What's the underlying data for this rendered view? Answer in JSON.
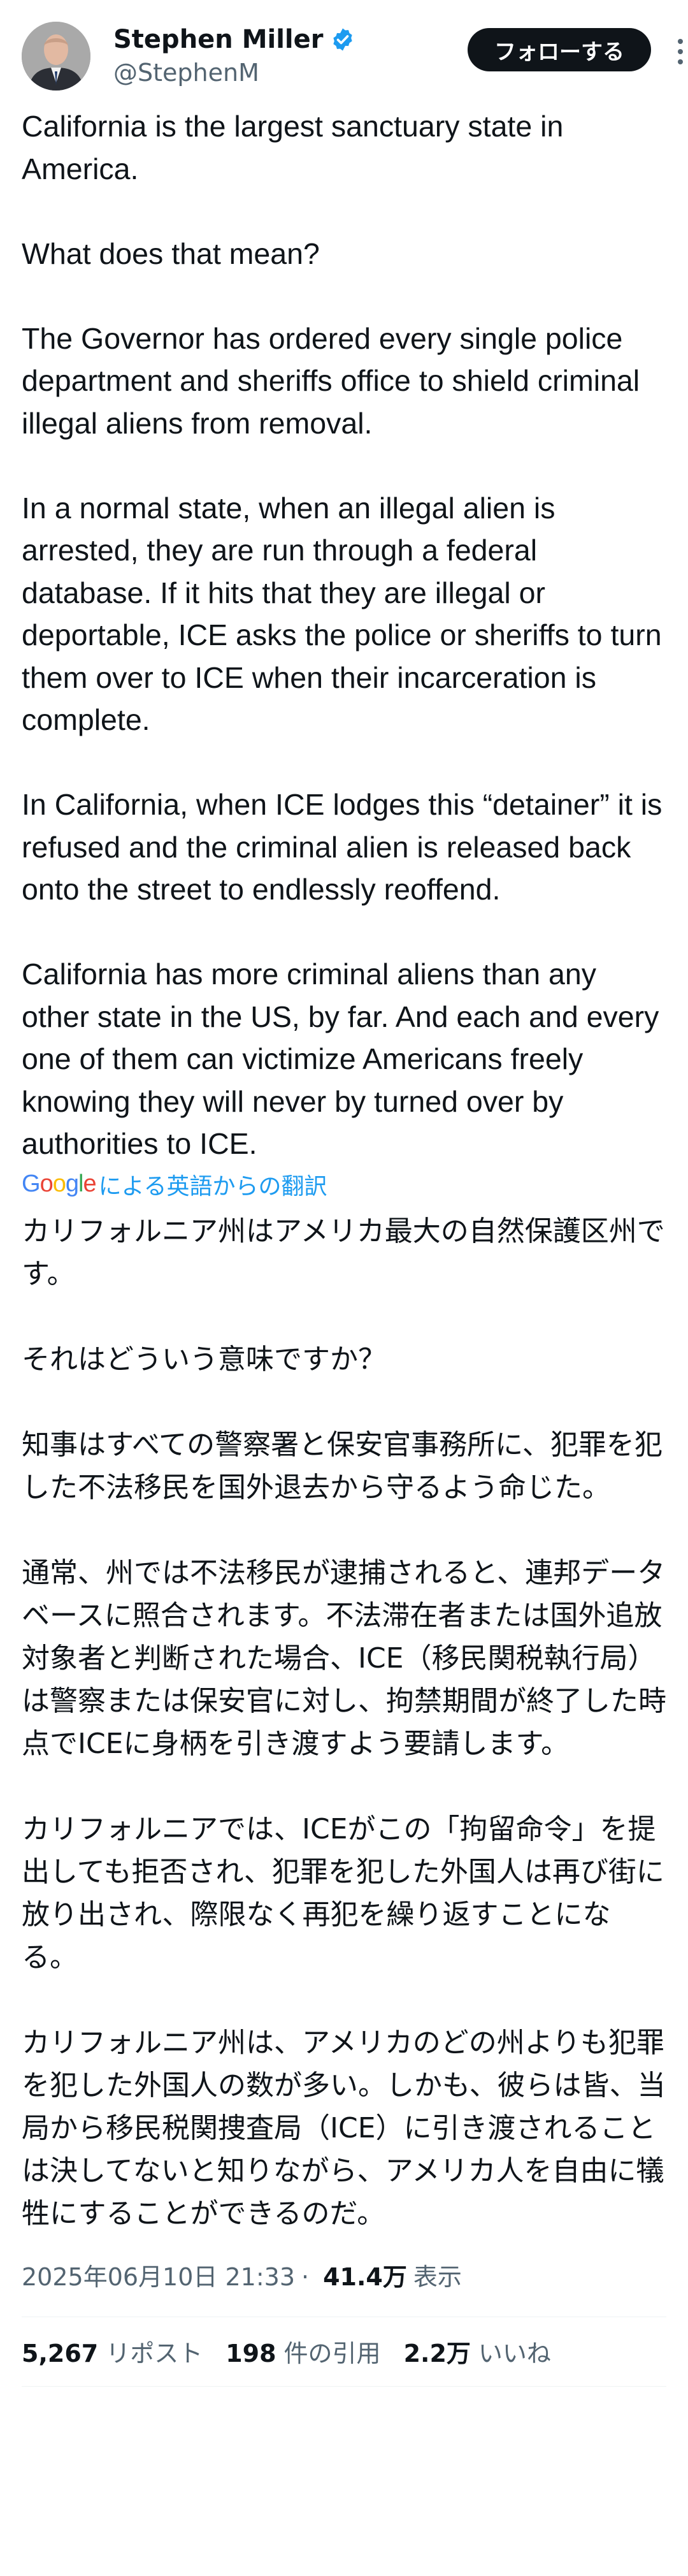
{
  "author": {
    "display_name": "Stephen Miller",
    "handle": "@StephenM",
    "verified": true
  },
  "follow_button_label": "フォローする",
  "tweet": {
    "original_text": "California is the largest sanctuary state in America.\n\nWhat does that mean?\n\nThe Governor has ordered every single police department and sheriffs office to shield criminal illegal aliens from removal.\n\nIn a normal state, when an illegal alien is arrested, they are run through a federal database. If it hits that they are illegal or deportable, ICE asks the police or sheriffs to turn them over to ICE when their incarceration is complete.\n\nIn California, when ICE lodges this “detainer” it is refused and the criminal alien is released back onto the street to endlessly reoffend.\n\nCalifornia has more criminal aliens than any other state in the US, by far. And each and every one of them can victimize Americans freely knowing they will never by turned over by authorities to ICE.",
    "translation_credit": "による英語からの翻訳",
    "translation_provider": "Google",
    "translated_text": "カリフォルニア州はアメリカ最大の自然保護区州です。\n\nそれはどういう意味ですか？\n\n知事はすべての警察署と保安官事務所に、犯罪を犯した不法移民を国外退去から守るよう命じた。\n\n通常、州では不法移民が逮捕されると、連邦データベースに照合されます。不法滞在者または国外追放対象者と判断された場合、ICE（移民関税執行局）は警察または保安官に対し、拘禁期間が終了した時点でICEに身柄を引き渡すよう要請します。\n\nカリフォルニアでは、ICEがこの「拘留命令」を提出しても拒否され、犯罪を犯した外国人は再び街に放り出され、際限なく再犯を繰り返すことになる。\n\nカリフォルニア州は、アメリカのどの州よりも犯罪を犯した外国人の数が多い。しかも、彼らは皆、当局から移民税関捜査局（ICE）に引き渡されることは決してないと知りながら、アメリカ人を自由に犠牲にすることができるのだ。"
  },
  "meta": {
    "timestamp": "2025年06月10日 21:33",
    "separator": "·",
    "views": "41.4万",
    "views_label": "表示"
  },
  "stats": [
    {
      "value": "5,267",
      "label": "リポスト"
    },
    {
      "value": "198",
      "label": "件の引用"
    },
    {
      "value": "2.2万",
      "label": "いいね"
    }
  ],
  "colors": {
    "text": "#0f1419",
    "secondary": "#536471",
    "link": "#1d9bf0",
    "verified": "#1d9bf0",
    "button_bg": "#0f1419"
  },
  "icons": {
    "verified": "verified-badge-icon",
    "more": "more-vertical-icon"
  }
}
